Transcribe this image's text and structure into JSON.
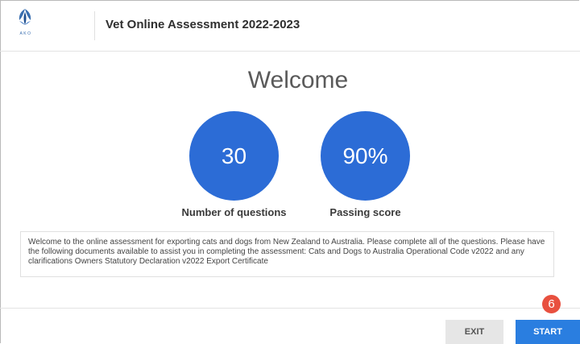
{
  "header": {
    "logo_text": "AKO",
    "title": "Vet Online Assessment 2022-2023"
  },
  "main": {
    "welcome": "Welcome",
    "stats": [
      {
        "value": "30",
        "label": "Number of questions"
      },
      {
        "value": "90%",
        "label": "Passing score"
      }
    ],
    "intro_text": "Welcome to the online assessment for exporting cats and dogs from New Zealand to Australia. Please complete all of the questions. Please have the following documents available to assist you in completing the assessment: Cats and Dogs to Australia Operational Code  v2022 and any clarifications Owners Statutory Declaration v2022 Export Certificate"
  },
  "footer": {
    "exit_label": "EXIT",
    "start_label": "START",
    "step_badge": "6"
  },
  "colors": {
    "accent_blue": "#2c6cd6",
    "start_button": "#2a7ee0",
    "badge": "#e8503f"
  },
  "icons": {
    "logo": "ako-logo-icon"
  }
}
